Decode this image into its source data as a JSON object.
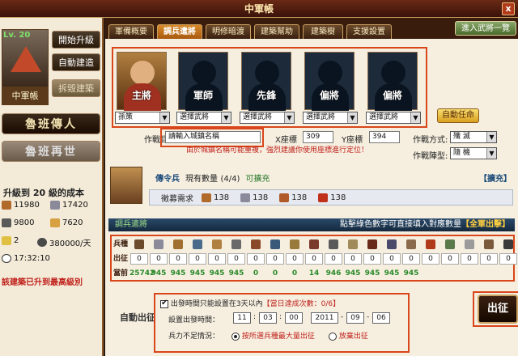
{
  "window": {
    "title": "中軍帳",
    "close": "x"
  },
  "left": {
    "level": "Lv. 20",
    "building_name": "中軍帳",
    "buttons": {
      "upgrade": "開始升級",
      "auto_build": "自動建造",
      "demolish": "拆毀建築"
    },
    "big_buttons": {
      "legend": "魯班傳人",
      "reborn": "魯班再世"
    },
    "cost_title": "升級到 20 級的成本",
    "resources": [
      {
        "icon": "wood-icon",
        "value": "11980",
        "color": "#b06a2a"
      },
      {
        "icon": "stone-icon",
        "value": "17420",
        "color": "#8a8a9a"
      },
      {
        "icon": "iron-icon",
        "value": "9800",
        "color": "#5a5a5a"
      },
      {
        "icon": "food-icon",
        "value": "7620",
        "color": "#d8a040"
      },
      {
        "icon": "gold-icon",
        "value": "2",
        "color": "#e0c040"
      },
      {
        "icon": "pop-icon",
        "value": "380000/天",
        "color": "#4a4a4a"
      }
    ],
    "time": "17:32:10",
    "max_msg": "該建築已升到最高級別"
  },
  "tabs": [
    "軍備概要",
    "調兵遣將",
    "明修暗渡",
    "建築幫助",
    "建築樹",
    "支援設置"
  ],
  "active_tab": 1,
  "recruit_general": "進入武將一覽",
  "slots": [
    {
      "label": "主將",
      "general": true
    },
    {
      "label": "軍師",
      "general": false
    },
    {
      "label": "先鋒",
      "general": false
    },
    {
      "label": "偏將",
      "general": false
    },
    {
      "label": "偏將",
      "general": false
    }
  ],
  "slot_selects": [
    "孫策",
    "選擇武將",
    "選擇武將",
    "選擇武將",
    "選擇武將"
  ],
  "auto_assign": "自動任命",
  "target": {
    "label": "作戰目標",
    "placeholder": "請輸入城鎮名稱",
    "x_label": "X座標",
    "x_val": "309",
    "y_label": "Y座標",
    "y_val": "394",
    "mode_label": "作戰方式:",
    "mode_val": "殲 滅",
    "formation_label": "作戰陣型:",
    "formation_val": "隨 機",
    "warning": "由於城鎮名稱可能重複，強烈建議你使用座標進行定位！"
  },
  "unit": {
    "name": "傳令兵",
    "count_label": "現有數量",
    "count": "(4/4)",
    "can_expand": "可擴充",
    "expand_link": "【擴充】",
    "need_label": "徵募需求",
    "needs": [
      {
        "icon": "wood-icon",
        "value": "138",
        "color": "#b06a2a"
      },
      {
        "icon": "stone-icon",
        "value": "138",
        "color": "#8a8a9a"
      },
      {
        "icon": "iron-icon",
        "value": "138",
        "color": "#b05a2a"
      },
      {
        "icon": "food-icon",
        "value": "138",
        "color": "#c0301a"
      }
    ]
  },
  "deploy": {
    "title": "調兵遣將",
    "hint": "點擊綠色數字可直接填入對應數量",
    "all_out": "【全軍出擊】",
    "row_labels": {
      "type": "兵種",
      "out": "出征",
      "now": "當前"
    },
    "unit_colors": [
      "#6a4a2a",
      "#8a8a9a",
      "#a07030",
      "#4a6a8a",
      "#b08040",
      "#6a6a6a",
      "#8a4a2a",
      "#3a5a7a",
      "#9a7a3a",
      "#7a3a2a",
      "#5a5a5a",
      "#a08a5a",
      "#6a2a1a",
      "#4a4a6a",
      "#8a6a4a",
      "#b03a1a",
      "#5a7a4a",
      "#9a9a9a",
      "#7a5a3a",
      "#3a3a3a",
      "#a06a3a",
      "#c0a060"
    ],
    "out_values": [
      "0",
      "0",
      "0",
      "0",
      "0",
      "0",
      "0",
      "0",
      "0",
      "0",
      "0",
      "0",
      "0",
      "0",
      "0",
      "0",
      "0",
      "0",
      "0",
      "0"
    ],
    "current_values": [
      "25742",
      "945",
      "945",
      "945",
      "945",
      "945",
      "0",
      "0",
      "0",
      "14",
      "946",
      "945",
      "945",
      "945",
      "945",
      "",
      "",
      "",
      "",
      "",
      ""
    ]
  },
  "auto_march": {
    "label": "自動出征",
    "line1": "出發時間只能設置在3天以內",
    "line1_count": "【當日達成次數：0/6】",
    "time_label": "設置出發時間：",
    "hh": "11",
    "mm": "03",
    "ss": "00",
    "year": "2011",
    "month": "09",
    "day": "06",
    "shortage_label": "兵力不足情況：",
    "opt1": "按所選兵種最大量出征",
    "opt2": "放棄出征"
  },
  "go_button": "出征"
}
